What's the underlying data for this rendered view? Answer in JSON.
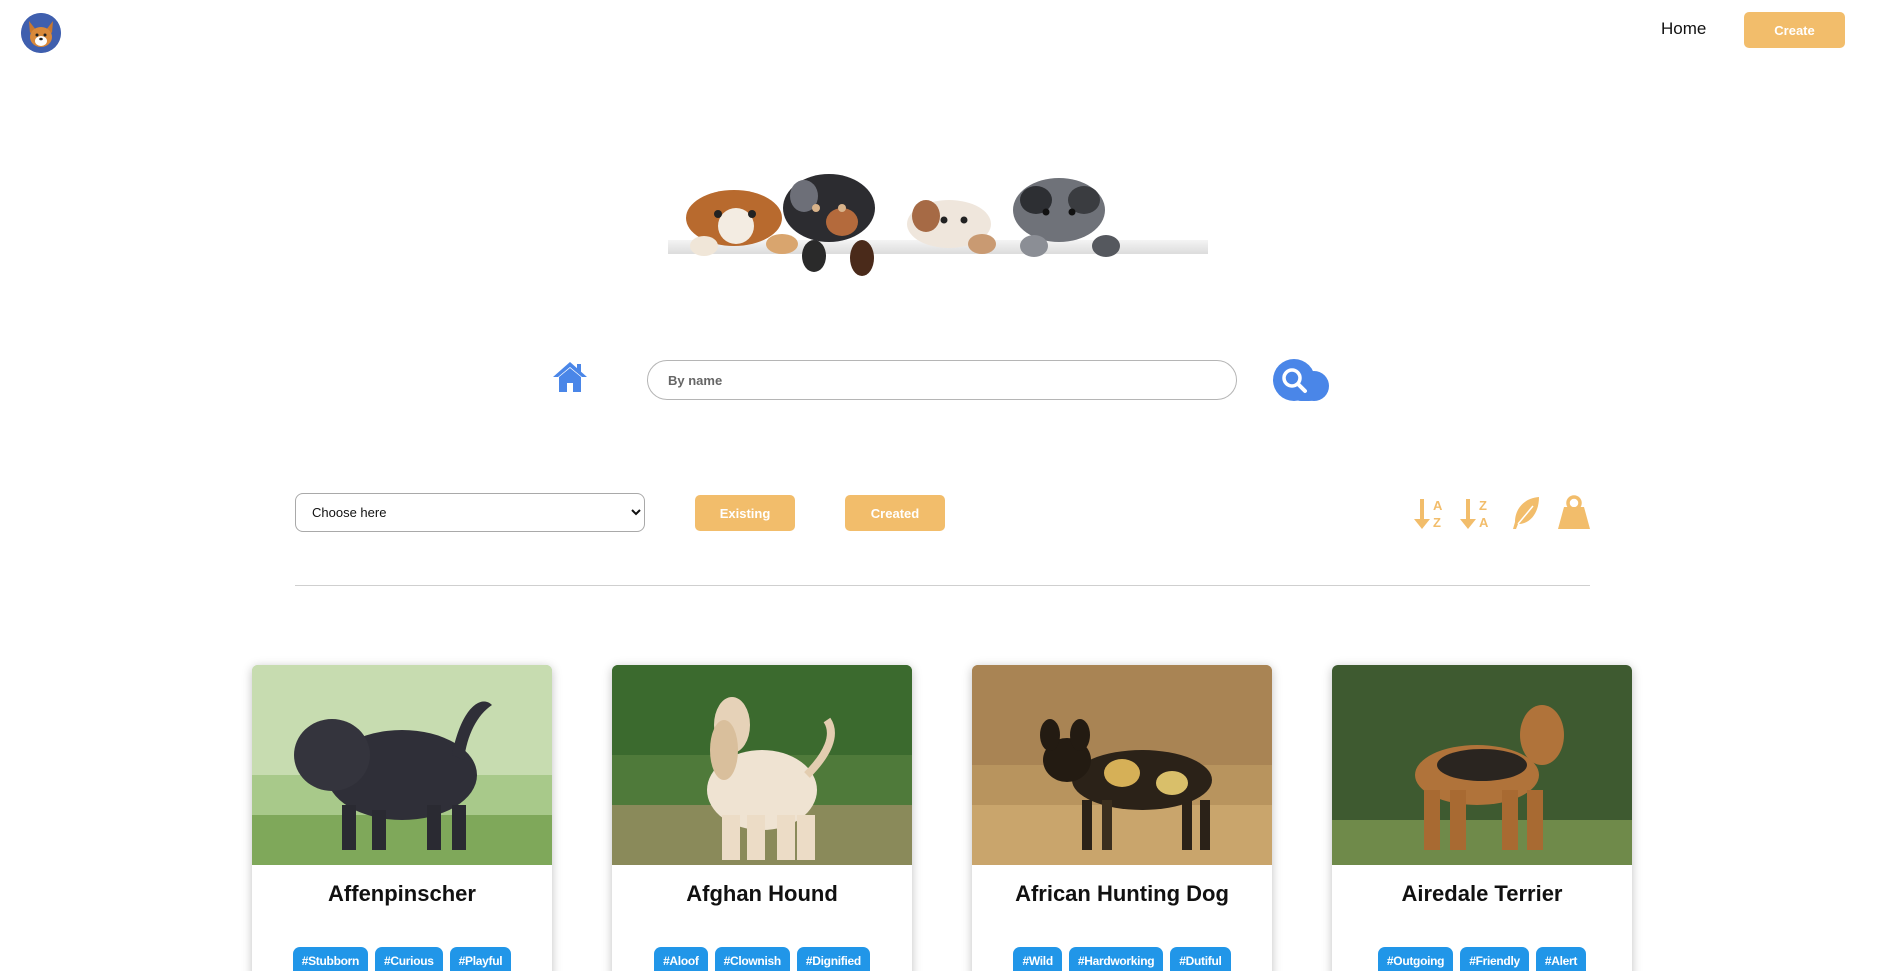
{
  "nav": {
    "home_label": "Home",
    "create_label": "Create"
  },
  "search": {
    "placeholder": "By name"
  },
  "filters": {
    "temperament_selected": "Choose here",
    "existing_label": "Existing",
    "created_label": "Created"
  },
  "sort_icons": [
    "sort-alpha-asc-icon",
    "sort-alpha-desc-icon",
    "feather-weight-icon",
    "heavy-weight-icon"
  ],
  "colors": {
    "accent": "#f2bd6b",
    "primary_blue": "#4a86e8",
    "tag_blue": "#2196e8"
  },
  "cards": [
    {
      "name": "Affenpinscher",
      "tags": [
        "#Stubborn",
        "#Curious",
        "#Playful"
      ]
    },
    {
      "name": "Afghan Hound",
      "tags": [
        "#Aloof",
        "#Clownish",
        "#Dignified"
      ]
    },
    {
      "name": "African Hunting Dog",
      "tags": [
        "#Wild",
        "#Hardworking",
        "#Dutiful"
      ]
    },
    {
      "name": "Airedale Terrier",
      "tags": [
        "#Outgoing",
        "#Friendly",
        "#Alert"
      ]
    }
  ]
}
